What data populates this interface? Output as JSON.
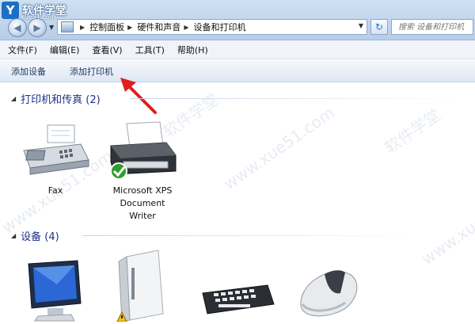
{
  "watermark": {
    "brand": "软件学堂",
    "site": "xue51.com",
    "wm_text": "软件学堂",
    "wm_url": "www.xue51.com"
  },
  "breadcrumb": [
    "控制面板",
    "硬件和声音",
    "设备和打印机"
  ],
  "search": {
    "placeholder": "搜索 设备和打印机"
  },
  "menu": [
    "文件(F)",
    "编辑(E)",
    "查看(V)",
    "工具(T)",
    "帮助(H)"
  ],
  "commands": {
    "add_device": "添加设备",
    "add_printer": "添加打印机"
  },
  "groups": {
    "printers": {
      "label": "打印机和传真 (2)"
    },
    "devices": {
      "label": "设备 (4)"
    }
  },
  "printers": [
    {
      "name": "Fax"
    },
    {
      "name_lines": [
        "Microsoft XPS",
        "Document",
        "Writer"
      ]
    }
  ],
  "icons": {
    "back": "back-arrow-icon",
    "forward": "forward-arrow-icon",
    "refresh": "refresh-icon",
    "search": "search-icon",
    "check": "default-check-icon"
  },
  "colors": {
    "group_label": "#1e3287",
    "arrow": "#e02020",
    "check": "#2e9d2e"
  }
}
